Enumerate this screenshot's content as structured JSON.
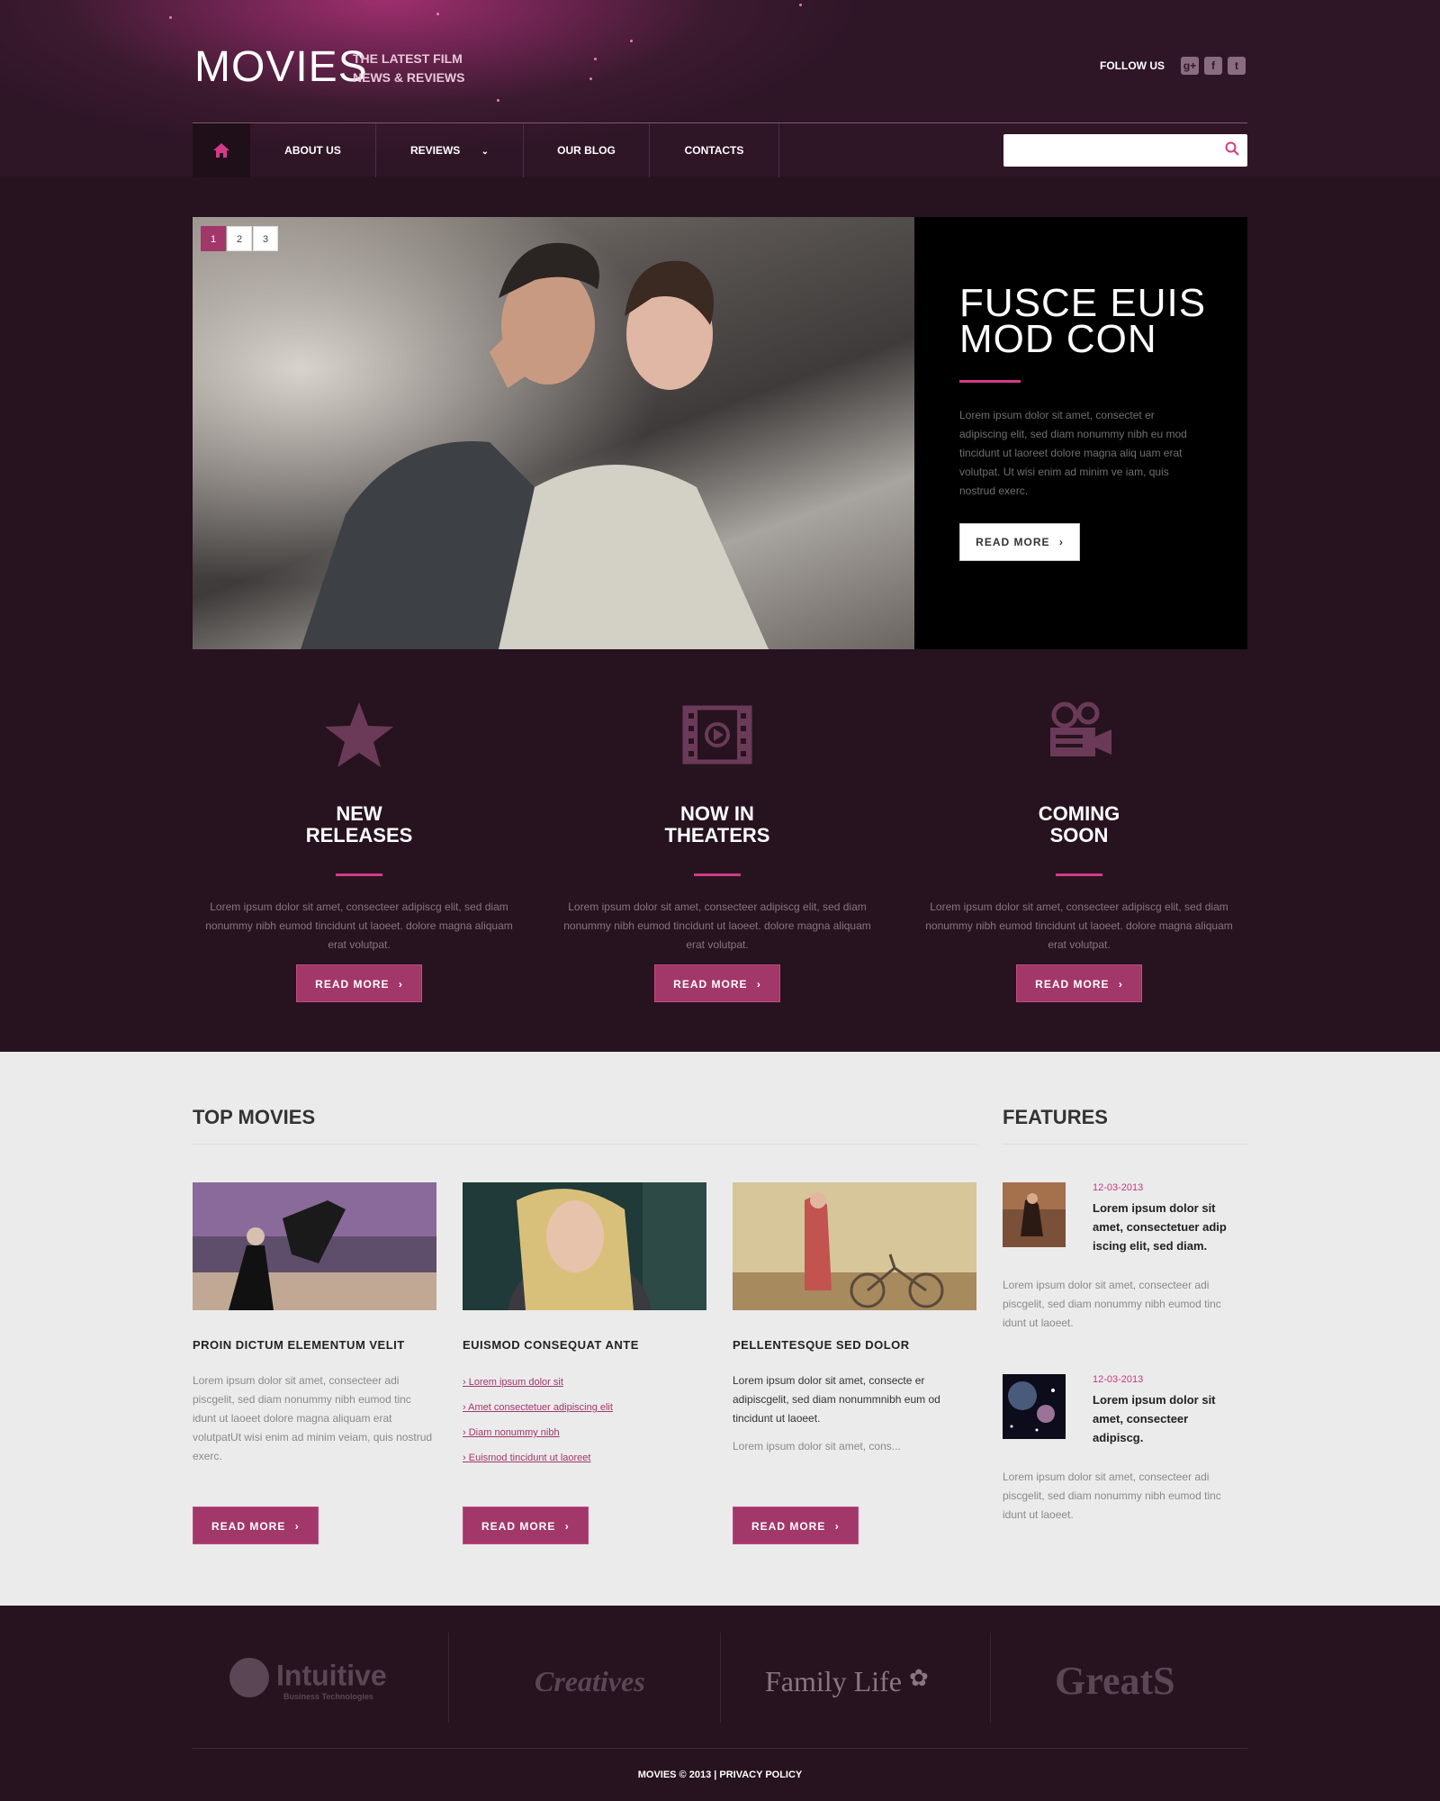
{
  "brand": {
    "title": "MOVIES",
    "tagline": "THE LATEST FILM NEWS & REVIEWS"
  },
  "follow_label": "FOLLOW US",
  "social_icons": [
    "google-plus-icon",
    "facebook-icon",
    "twitter-icon"
  ],
  "nav": {
    "items": [
      "ABOUT US",
      "REVIEWS",
      "OUR BLOG",
      "CONTACTS"
    ],
    "reviews_dropdown_icon": "chevron-down-icon"
  },
  "search": {
    "placeholder": ""
  },
  "slider": {
    "pages": [
      "1",
      "2",
      "3"
    ],
    "active_page": 1,
    "title": "FUSCE EUIS MOD CON",
    "text": "Lorem ipsum dolor sit amet, consectet er adipiscing elit, sed diam nonummy nibh eu mod tincidunt ut laoreet dolore magna aliq uam erat volutpat. Ut wisi enim ad minim ve iam, quis nostrud exerc.",
    "button": "READ MORE"
  },
  "features": [
    {
      "icon": "star-icon",
      "title": "NEW RELEASES",
      "text": "Lorem ipsum dolor sit amet, consecteer adipiscg elit, sed diam nonummy nibh eumod tincidunt ut laoeet. dolore magna aliquam erat volutpat.",
      "button": "READ MORE"
    },
    {
      "icon": "film-icon",
      "title": "NOW IN THEATERS",
      "text": "Lorem ipsum dolor sit amet, consecteer adipiscg elit, sed diam nonummy nibh eumod tincidunt ut laoeet. dolore magna aliquam erat volutpat.",
      "button": "READ MORE"
    },
    {
      "icon": "movie-camera-icon",
      "title": "COMING SOON",
      "text": "Lorem ipsum dolor sit amet, consecteer adipiscg elit, sed diam nonummy nibh eumod tincidunt ut laoeet. dolore magna aliquam erat volutpat.",
      "button": "READ MORE"
    }
  ],
  "top_movies": {
    "heading": "TOP MOVIES",
    "movies": [
      {
        "title": "PROIN DICTUM ELEMENTUM VELIT",
        "text": "Lorem ipsum dolor sit amet, consecteer adi piscgelit, sed diam nonummy nibh eumod tinc idunt ut laoeet dolore magna aliquam erat volutpatUt wisi enim ad minim veiam, quis nostrud exerc.",
        "button": "READ MORE"
      },
      {
        "title": "EUISMOD CONSEQUAT ANTE",
        "links": [
          "Lorem ipsum dolor sit",
          "Amet consectetuer adipiscing elit",
          "Diam nonummy nibh",
          "Euismod tincidunt ut laoreet"
        ],
        "button": "READ MORE"
      },
      {
        "title": "PELLENTESQUE SED DOLOR",
        "text_bold": "Lorem ipsum dolor sit amet, consecte er adipiscgelit, sed diam nonummnibh eum od tincidunt ut laoeet.",
        "text": "Lorem ipsum dolor sit amet, cons...",
        "button": "READ MORE"
      }
    ]
  },
  "features_sidebar": {
    "heading": "FEATURES",
    "items": [
      {
        "date": "12-03-2013",
        "title": "Lorem ipsum dolor sit amet, consectetuer adip iscing elit, sed diam.",
        "text": "Lorem ipsum dolor sit amet, consecteer adi piscgelit, sed diam nonummy nibh eumod tinc idunt ut laoeet."
      },
      {
        "date": "12-03-2013",
        "title": "Lorem ipsum dolor sit amet, consecteer adipiscg.",
        "text": "Lorem ipsum dolor sit amet, consecteer adi piscgelit, sed diam nonummy nibh eumod tinc idunt ut laoeet."
      }
    ]
  },
  "footer": {
    "partners": [
      {
        "name": "Intuitive",
        "sub": "Business Technologies"
      },
      {
        "name": "Creatives"
      },
      {
        "name": "Family Life"
      },
      {
        "name": "GreatS"
      }
    ],
    "copyright": "MOVIES © 2013 | PRIVACY POLICY"
  },
  "colors": {
    "accent": "#d33a86",
    "button": "#a23769",
    "dark_bg": "#26131f",
    "light_bg": "#ebebeb"
  }
}
